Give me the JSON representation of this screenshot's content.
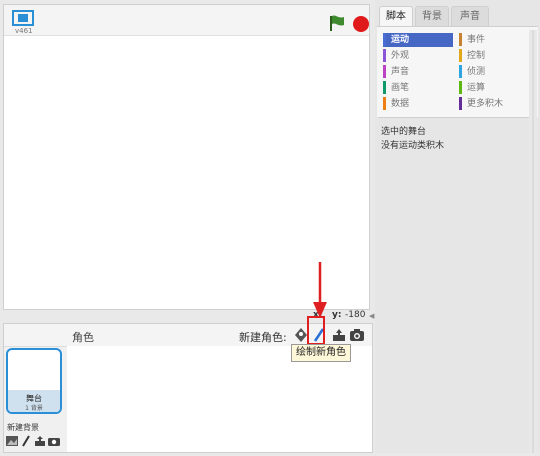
{
  "stage": {
    "version": "v461",
    "coords": {
      "x_label": "x:",
      "x_value": "",
      "y_label": "y:",
      "y_value": "-180"
    }
  },
  "sprites": {
    "header_label": "角色",
    "new_sprite_label": "新建角色:",
    "tooltip": "绘制新角色",
    "tools": [
      "library-icon",
      "paint-icon",
      "upload-icon",
      "camera-icon"
    ]
  },
  "stage_thumb": {
    "name": "舞台",
    "backdrop_count": "1 背景",
    "new_backdrop_label": "新建背景"
  },
  "tabs": [
    "脚本",
    "背景",
    "声音"
  ],
  "categories": [
    {
      "label": "运动",
      "color": "#4a6cd4"
    },
    {
      "label": "事件",
      "color": "#c88330"
    },
    {
      "label": "外观",
      "color": "#8a55d7"
    },
    {
      "label": "控制",
      "color": "#e1a91a"
    },
    {
      "label": "声音",
      "color": "#bb42c3"
    },
    {
      "label": "侦测",
      "color": "#2ca5e2"
    },
    {
      "label": "画笔",
      "color": "#0e9a6c"
    },
    {
      "label": "运算",
      "color": "#5cb712"
    },
    {
      "label": "数据",
      "color": "#ee7d16"
    },
    {
      "label": "更多积木",
      "color": "#632d99"
    }
  ],
  "palette_info": {
    "selected_target": "选中的舞台",
    "no_blocks": "没有运动类积木"
  },
  "colors": {
    "accent": "#2b8fd6",
    "stop": "#e01a1a",
    "flag": "#3f8a2e",
    "highlight": "#e02020"
  }
}
